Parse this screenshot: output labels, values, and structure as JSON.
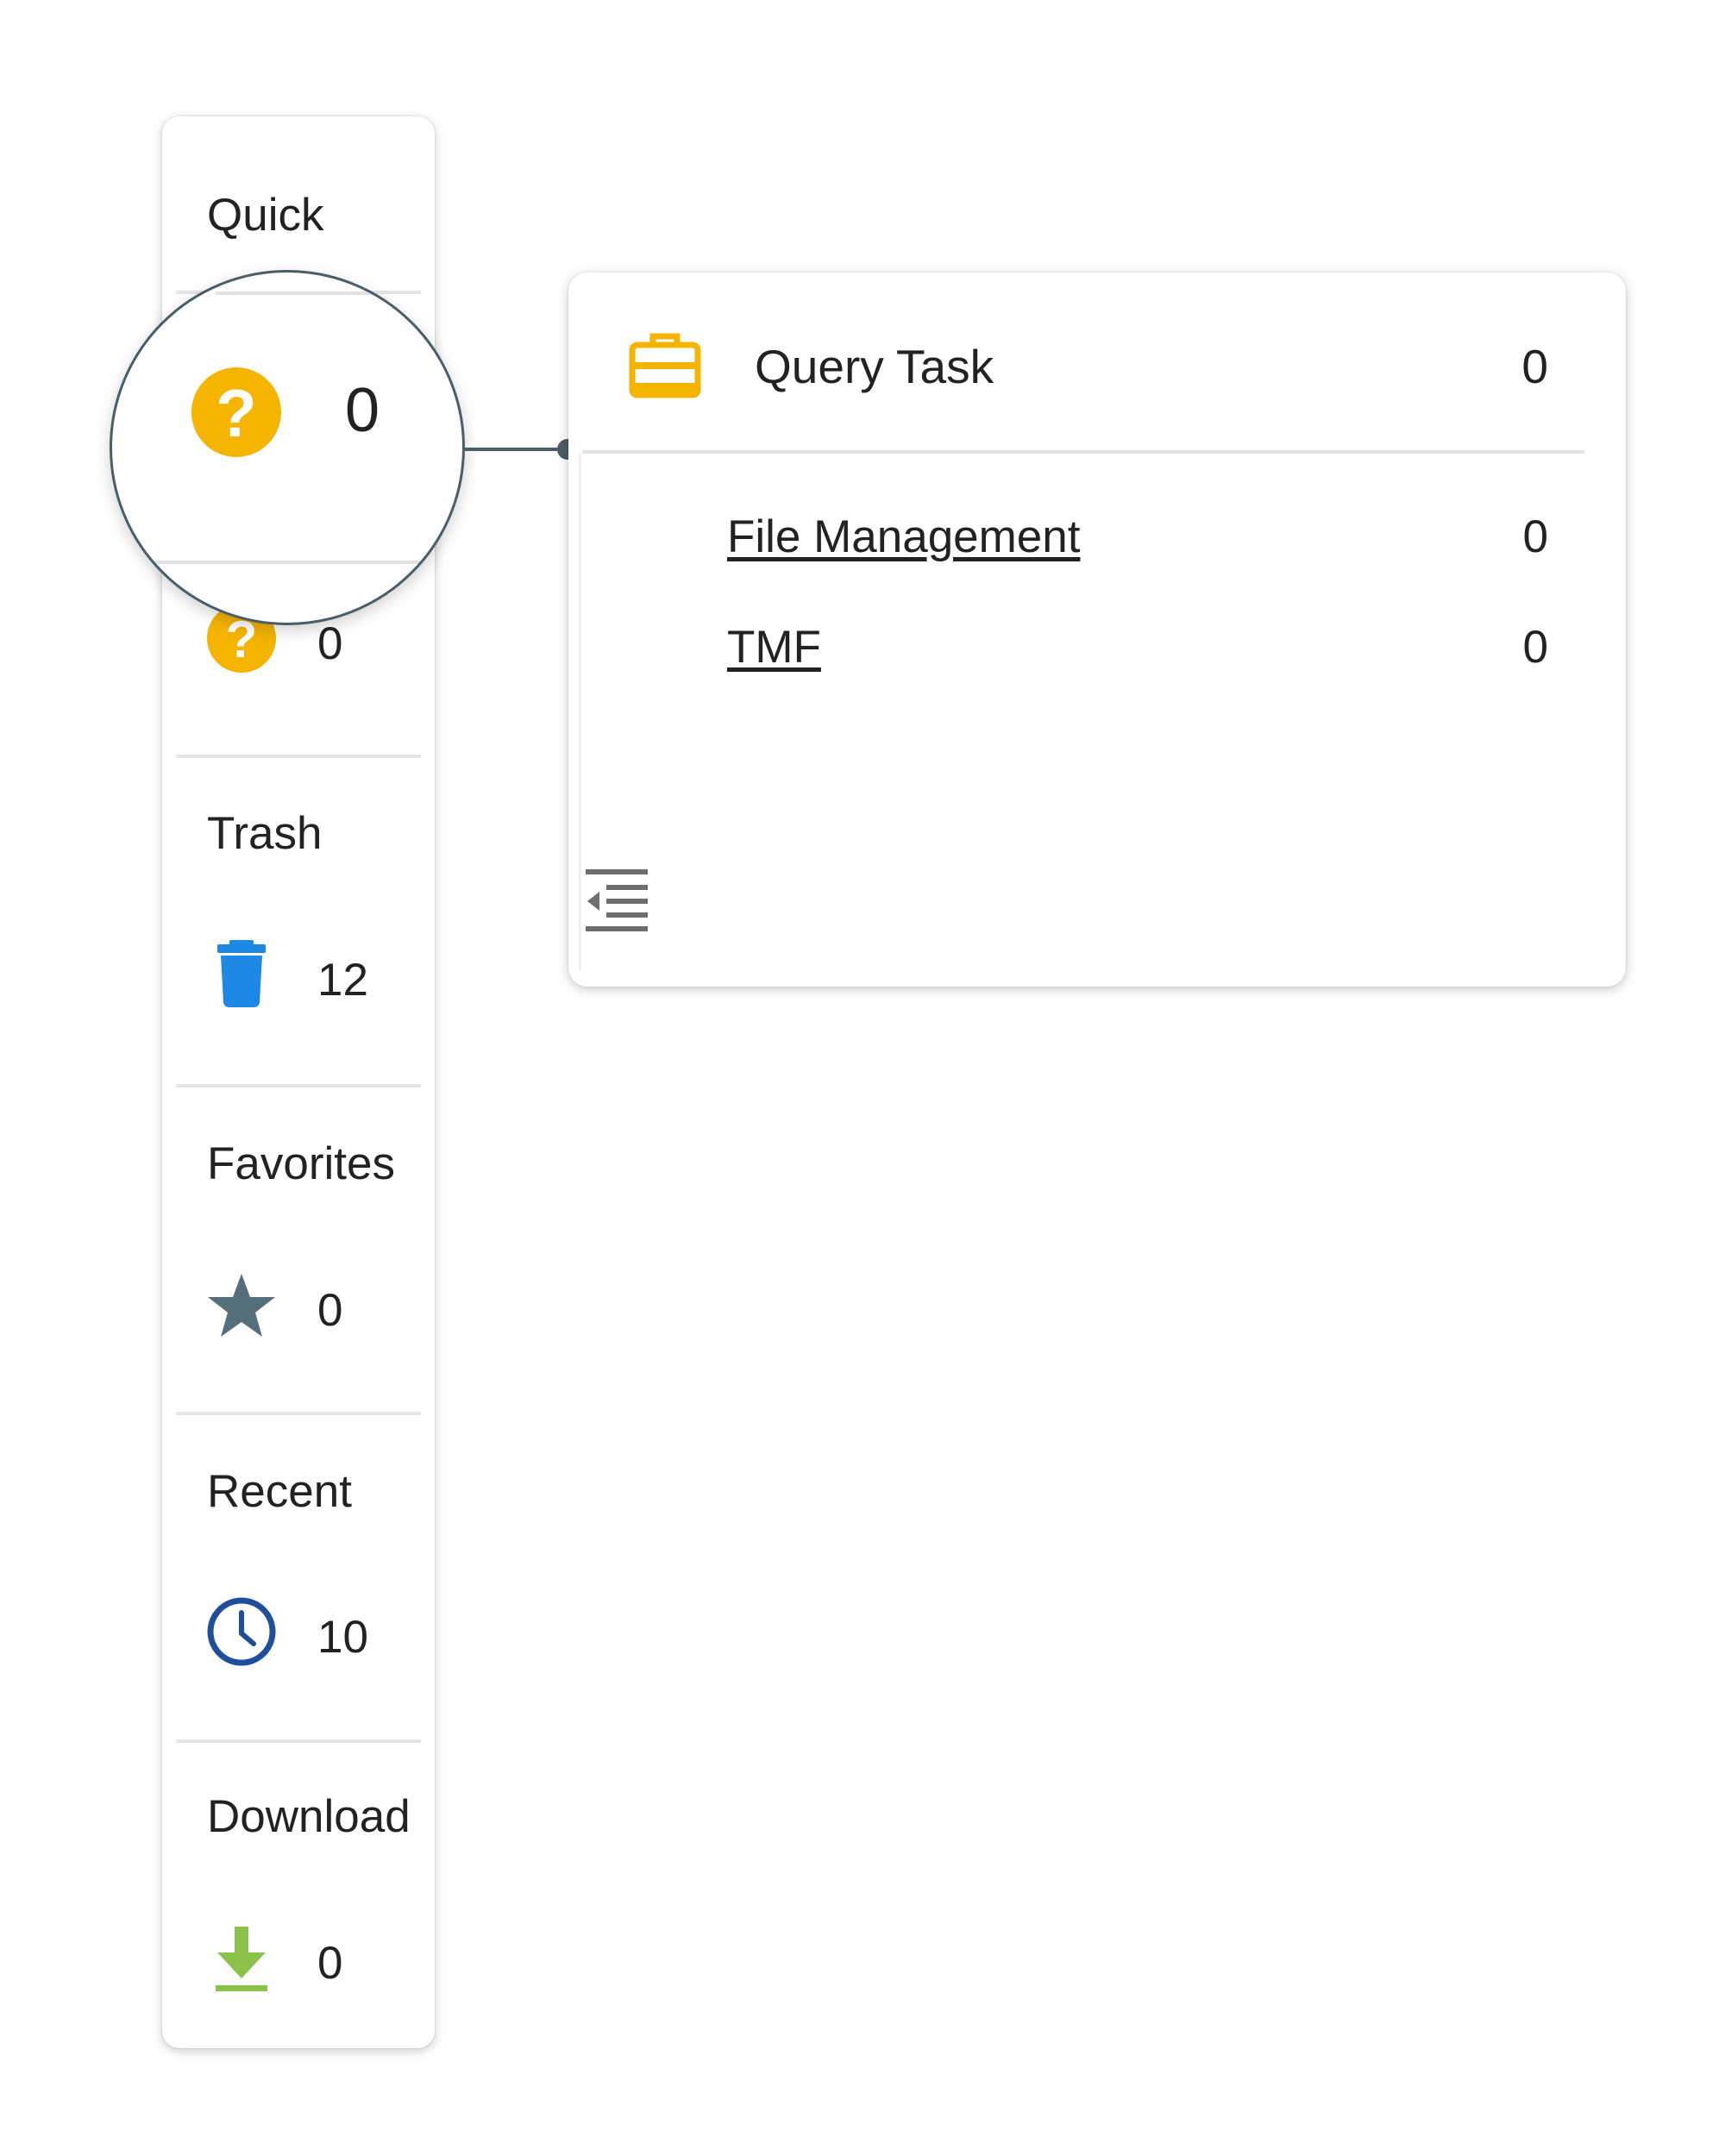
{
  "sidebar": {
    "sections": [
      {
        "title": "Quick",
        "count": ""
      },
      {
        "title": "",
        "count": "0",
        "icon": "help-circle-icon"
      },
      {
        "title": "Trash",
        "count": "12",
        "icon": "trash-icon"
      },
      {
        "title": "Favorites",
        "count": "0",
        "icon": "star-icon"
      },
      {
        "title": "Recent",
        "count": "10",
        "icon": "clock-icon"
      },
      {
        "title": "Download",
        "count": "0",
        "icon": "download-icon"
      }
    ]
  },
  "magnifier": {
    "count": "0",
    "icon": "help-circle-icon"
  },
  "panel": {
    "title": "Query Task",
    "count": "0",
    "icon": "briefcase-icon",
    "items": [
      {
        "label": "File Management",
        "count": "0"
      },
      {
        "label": "TMF",
        "count": "0"
      }
    ],
    "collapse_icon": "collapse-menu-icon"
  },
  "colors": {
    "query_yellow": "#f5b400",
    "trash_blue": "#1e88e5",
    "star_slate": "#546e7a",
    "clock_navy": "#1f4e9c",
    "download_green": "#8bc34a",
    "connector": "#4b5d66"
  }
}
